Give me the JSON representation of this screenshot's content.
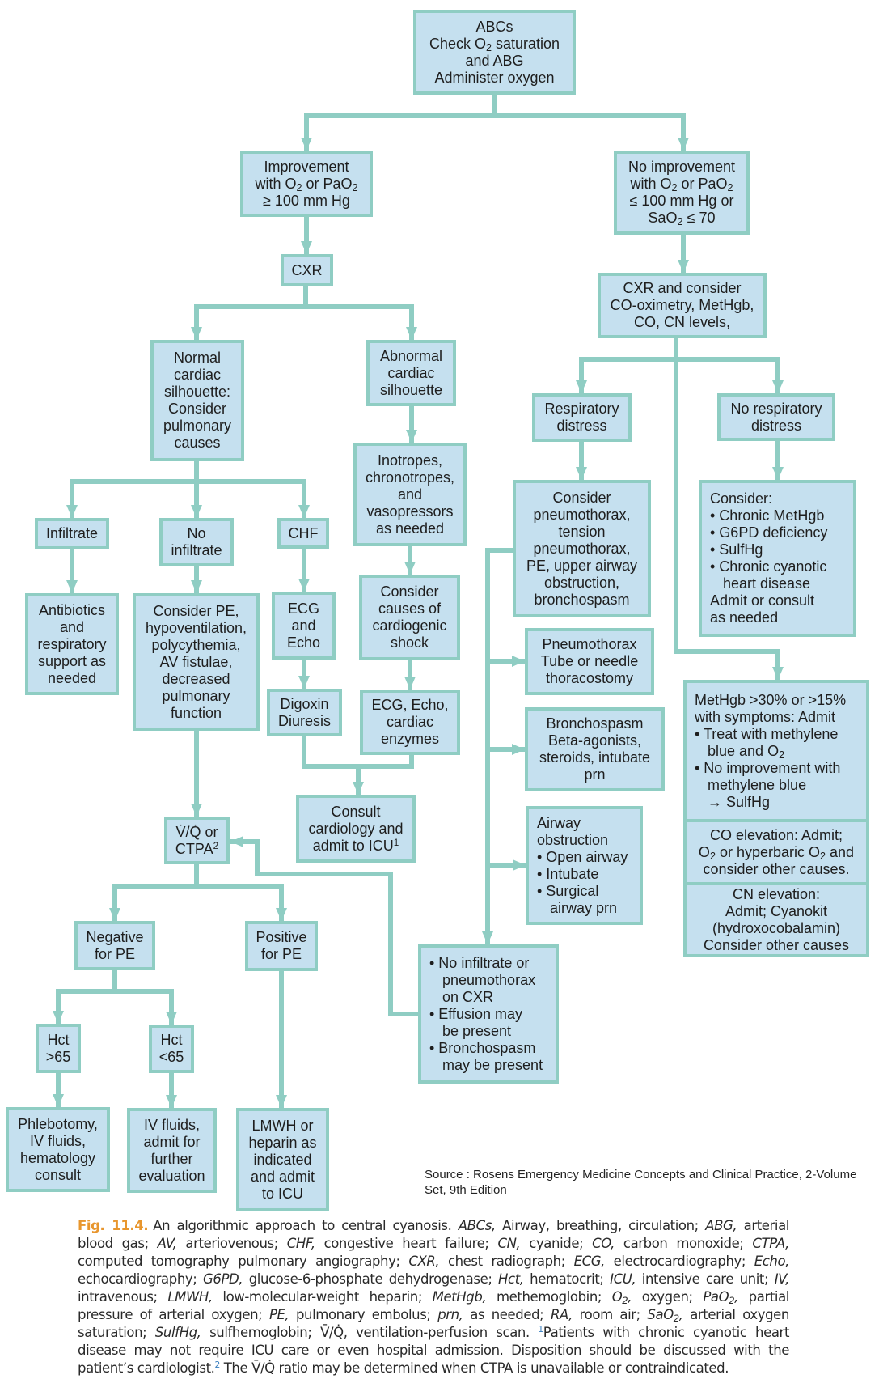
{
  "colors": {
    "box_fill": "#c5e0ef",
    "box_border": "#8fcdc3",
    "connector": "#8fcdc3",
    "fig_label": "#e8962e"
  },
  "nodes": {
    "abcs": [
      "ABCs",
      "Check O<sub>2</sub> saturation",
      "and ABG",
      "Administer oxygen"
    ],
    "improvement": [
      "Improvement",
      "with O<sub>2</sub> or PaO<sub>2</sub>",
      "≥ 100 mm Hg"
    ],
    "no_improvement": [
      "No improvement",
      "with O<sub>2</sub> or PaO<sub>2</sub>",
      "≤ 100 mm Hg or",
      "SaO<sub>2</sub> ≤ 70"
    ],
    "cxr": [
      "CXR"
    ],
    "cxr_consider": [
      "CXR and consider",
      "CO-oximetry, MetHgb,",
      "CO, CN levels,"
    ],
    "normal_silhouette": [
      "Normal",
      "cardiac",
      "silhouette:",
      "Consider",
      "pulmonary",
      "causes"
    ],
    "abnormal_silhouette": [
      "Abnormal",
      "cardiac",
      "silhouette"
    ],
    "respiratory_distress": [
      "Respiratory",
      "distress"
    ],
    "no_respiratory_distress": [
      "No respiratory",
      "distress"
    ],
    "infiltrate": [
      "Infiltrate"
    ],
    "no_infiltrate": [
      "No",
      "infiltrate"
    ],
    "chf": [
      "CHF"
    ],
    "inotropes": [
      "Inotropes,",
      "chronotropes,",
      "and",
      "vasopressors",
      "as needed"
    ],
    "consider_pneumothorax": [
      "Consider",
      "pneumothorax,",
      "tension",
      "pneumothorax,",
      "PE, upper airway",
      "obstruction,",
      "bronchospasm"
    ],
    "consider_chronic": [
      "Consider:",
      "• Chronic MetHgb",
      "• G6PD deficiency",
      "• SulfHg",
      "• Chronic cyanotic",
      "   heart disease",
      "Admit or consult",
      "as needed"
    ],
    "antibiotics": [
      "Antibiotics",
      "and",
      "respiratory",
      "support as",
      "needed"
    ],
    "consider_pe": [
      "Consider PE,",
      "hypoventilation,",
      "polycythemia,",
      "AV fistulae,",
      "decreased",
      "pulmonary",
      "function"
    ],
    "ecg_echo": [
      "ECG",
      "and",
      "Echo"
    ],
    "cardiogenic_shock": [
      "Consider",
      "causes of",
      "cardiogenic",
      "shock"
    ],
    "pneumothorax_tx": [
      "Pneumothorax",
      "Tube or needle",
      "thoracostomy"
    ],
    "methgb": [
      "MetHgb >30% or >15%",
      "with symptoms: Admit",
      "• Treat with methylene",
      "   blue and O<sub>2</sub>",
      "• No improvement with",
      "  methylene blue",
      "  → SulfHg"
    ],
    "digoxin": [
      "Digoxin",
      "Diuresis"
    ],
    "ecg_enzymes": [
      "ECG, Echo,",
      "cardiac",
      "enzymes"
    ],
    "bronchospasm_tx": [
      "Bronchospasm",
      "Beta-agonists,",
      "steroids, intubate",
      "prn"
    ],
    "co_elevation": [
      "CO elevation: Admit;",
      "O<sub>2</sub> or hyperbaric O<sub>2</sub> and",
      "consider other causes."
    ],
    "vq_ctpa": [
      "V̇/Q̇ or",
      "CTPA<sup>2</sup>"
    ],
    "consult_cardiology": [
      "Consult",
      "cardiology and",
      "admit to ICU<sup>1</sup>"
    ],
    "airway_obstruction": [
      "Airway",
      "obstruction",
      "• Open airway",
      "• Intubate",
      "• Surgical",
      "   airway prn"
    ],
    "cn_elevation": [
      "CN elevation:",
      "Admit; Cyanokit",
      "(hydroxocobalamin)",
      "Consider other causes"
    ],
    "negative_pe": [
      "Negative",
      "for PE"
    ],
    "positive_pe": [
      "Positive",
      "for PE"
    ],
    "no_infiltrate_cxr": [
      "• No infiltrate or",
      "   pneumothorax",
      "   on CXR",
      "• Effusion may",
      "   be present",
      "• Bronchospasm",
      "   may be present"
    ],
    "hct_high": [
      "Hct",
      ">65"
    ],
    "hct_low": [
      "Hct",
      "<65"
    ],
    "phlebotomy": [
      "Phlebotomy,",
      "IV fluids,",
      "hematology",
      "consult"
    ],
    "iv_fluids": [
      "IV fluids,",
      "admit for",
      "further",
      "evaluation"
    ],
    "lmwh": [
      "LMWH or",
      "heparin as",
      "indicated",
      "and admit",
      "to ICU"
    ]
  },
  "source": "Source : Rosens Emergency Medicine Concepts and Clinical Practice, 2-Volume Set, 9th Edition",
  "caption": {
    "label": "Fig. 11.4.",
    "html": "An algorithmic approach to central cyanosis. <i>ABCs,</i> Airway, breathing, circulation; <i>ABG,</i> arterial blood gas; <i>AV,</i> arteriovenous; <i>CHF,</i> congestive heart failure; <i>CN,</i> cyanide; <i>CO,</i> carbon monoxide; <i>CTPA,</i> computed tomography pulmonary angiography; <i>CXR,</i> chest radiograph; <i>ECG,</i> electrocardiography; <i>Echo,</i> echocardiography; <i>G6PD,</i> glucose-6-phosphate dehydrogenase; <i>Hct,</i> hematocrit; <i>ICU,</i> intensive care unit; <i>IV,</i> intravenous; <i>LMWH,</i> low-molecular-weight heparin; <i>MetHgb,</i> methemoglobin; <i>O<sub>2</sub>,</i> oxygen; <i>PaO<sub>2</sub>,</i> partial pressure of arterial oxygen; <i>PE,</i> pulmonary embolus; <i>prn,</i> as needed; <i>RA,</i> room air; <i>SaO<sub>2</sub>,</i> arterial oxygen saturation; <i>SulfHg,</i> sulfhemoglobin; V̄/Q̇, ventilation-perfusion scan. <sup style=\"color:#3a7fc0\">1</sup>Patients with chronic cyanotic heart disease may not require ICU care or even hospital admission. Disposition should be discussed with the patient’s cardiologist.<sup style=\"color:#3a7fc0\">2</sup> The V̄/Q̇ ratio may be determined when CTPA is unavailable or contraindicated."
  }
}
